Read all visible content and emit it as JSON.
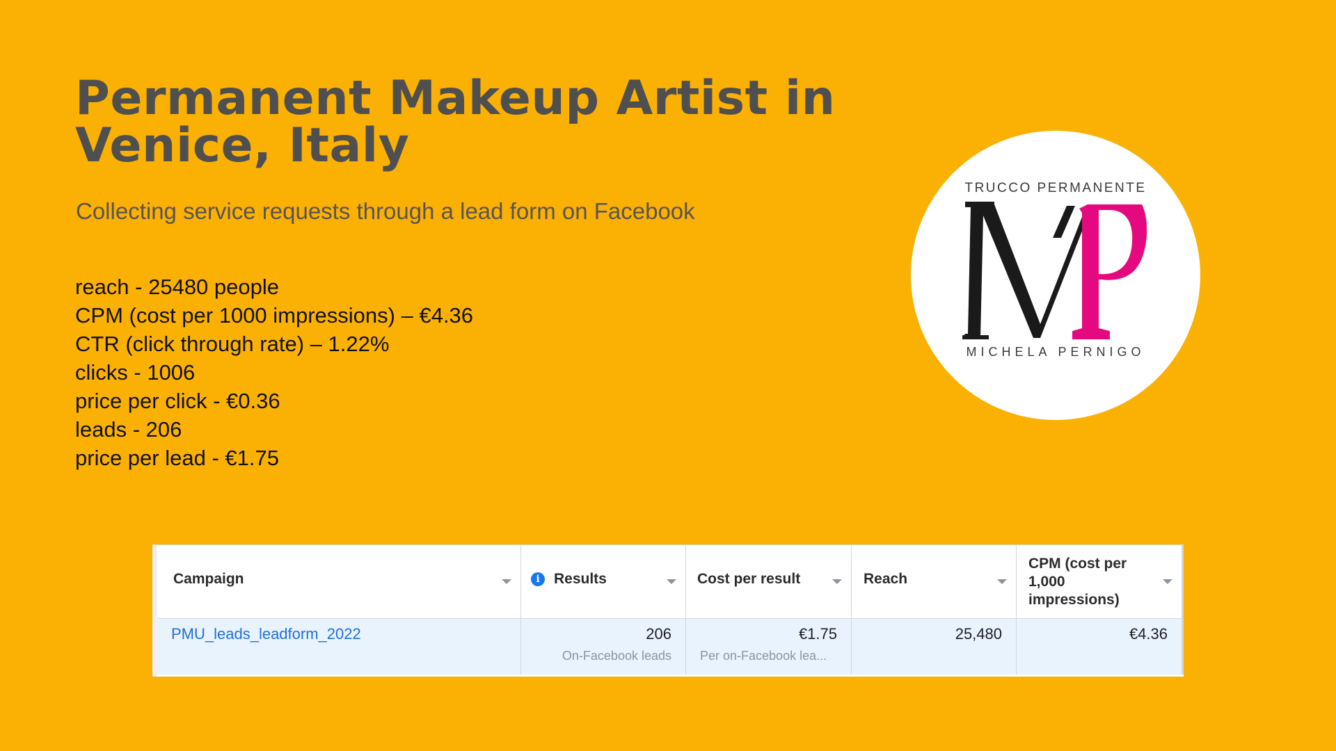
{
  "title": "Permanent Makeup Artist in Venice, Italy",
  "subtitle": "Collecting service requests through a lead form on Facebook",
  "stats": [
    "reach - 25480 people",
    "CPM (cost per 1000 impressions) – €4.36",
    "CTR (click through rate) – 1.22%",
    "clicks - 1006",
    "price per click - €0.36",
    "leads - 206",
    "price per lead - €1.75"
  ],
  "logo": {
    "top_text": "TRUCCO PERMANENTE",
    "bottom_text": "MICHELA PERNIGO",
    "colors": {
      "dark": "#1a1a1a",
      "magenta": "#e5097f"
    }
  },
  "table": {
    "headers": [
      "Campaign",
      "Results",
      "Cost per result",
      "Reach",
      "CPM (cost per 1,000 impressions)"
    ],
    "row": {
      "campaign": "PMU_leads_leadform_2022",
      "results": "206",
      "results_sub": "On-Facebook leads",
      "cost_per_result": "€1.75",
      "cost_sub": "Per on-Facebook lea...",
      "reach": "25,480",
      "cpm": "€4.36"
    }
  },
  "colors": {
    "background": "#FBB004",
    "title": "#4f4f4f",
    "link": "#216fdb",
    "row_highlight": "#e9f3fe"
  }
}
